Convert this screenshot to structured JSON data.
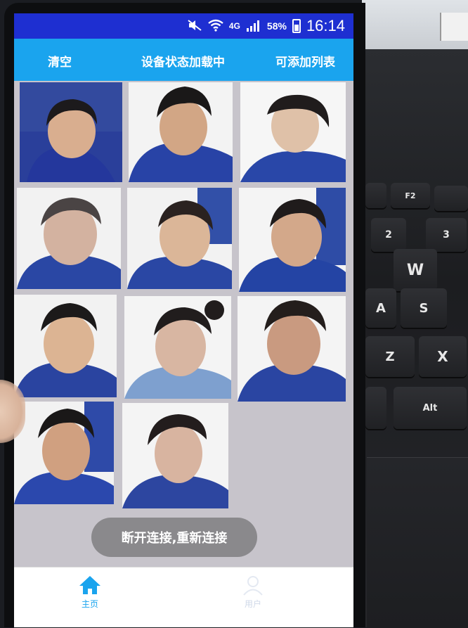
{
  "status_bar": {
    "network": "4G",
    "battery_percent": "58%",
    "time": "16:14",
    "icons": [
      "mute-icon",
      "wifi-icon",
      "signal-icon",
      "battery-icon"
    ]
  },
  "app_bar": {
    "left_action": "清空",
    "title": "设备状态加载中",
    "right_action": "可添加列表"
  },
  "photos": [
    {
      "name": "face-photo-1"
    },
    {
      "name": "face-photo-2"
    },
    {
      "name": "face-photo-3"
    },
    {
      "name": "face-photo-4"
    },
    {
      "name": "face-photo-5"
    },
    {
      "name": "face-photo-6"
    },
    {
      "name": "face-photo-7"
    },
    {
      "name": "face-photo-8"
    },
    {
      "name": "face-photo-9"
    },
    {
      "name": "face-photo-10"
    },
    {
      "name": "face-photo-11"
    }
  ],
  "toast": {
    "message": "断开连接,重新连接"
  },
  "bottom_nav": {
    "items": [
      {
        "label": "主页",
        "icon": "home-icon",
        "active": true
      },
      {
        "label": "用户",
        "icon": "user-icon",
        "active": false
      }
    ]
  },
  "keyboard_keys": [
    "F2",
    "2",
    "3",
    "W",
    "A",
    "S",
    "Z",
    "X",
    "Alt"
  ],
  "colors": {
    "status_bar": "#1e2fd1",
    "app_bar": "#1aa4ee",
    "active_nav": "#1aa4ee",
    "inactive_nav": "#cfd8e8"
  }
}
